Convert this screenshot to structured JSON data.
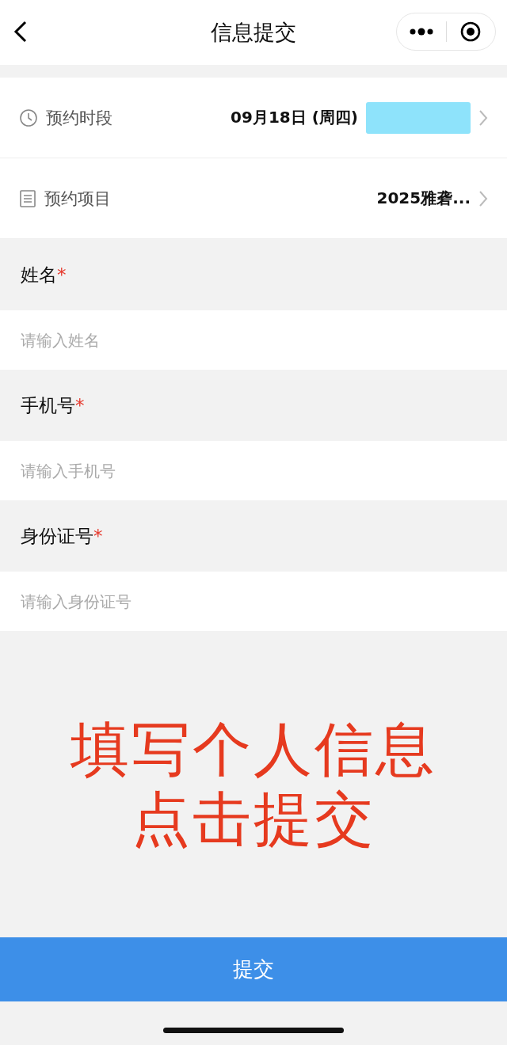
{
  "nav": {
    "title": "信息提交"
  },
  "booking_rows": [
    {
      "kind": "time",
      "label": "预约时段",
      "value": "09月18日 (周四)",
      "redacted": true
    },
    {
      "kind": "list",
      "label": "预约项目",
      "value": "2025雅砻...",
      "redacted": false
    }
  ],
  "fields": [
    {
      "label": "姓名",
      "required_mark": "*",
      "placeholder": "请输入姓名"
    },
    {
      "label": "手机号",
      "required_mark": "*",
      "placeholder": "请输入手机号"
    },
    {
      "label": "身份证号",
      "required_mark": "*",
      "placeholder": "请输入身份证号"
    }
  ],
  "annotation": [
    "填写个人信息",
    "点击提交"
  ],
  "submit": "提交"
}
